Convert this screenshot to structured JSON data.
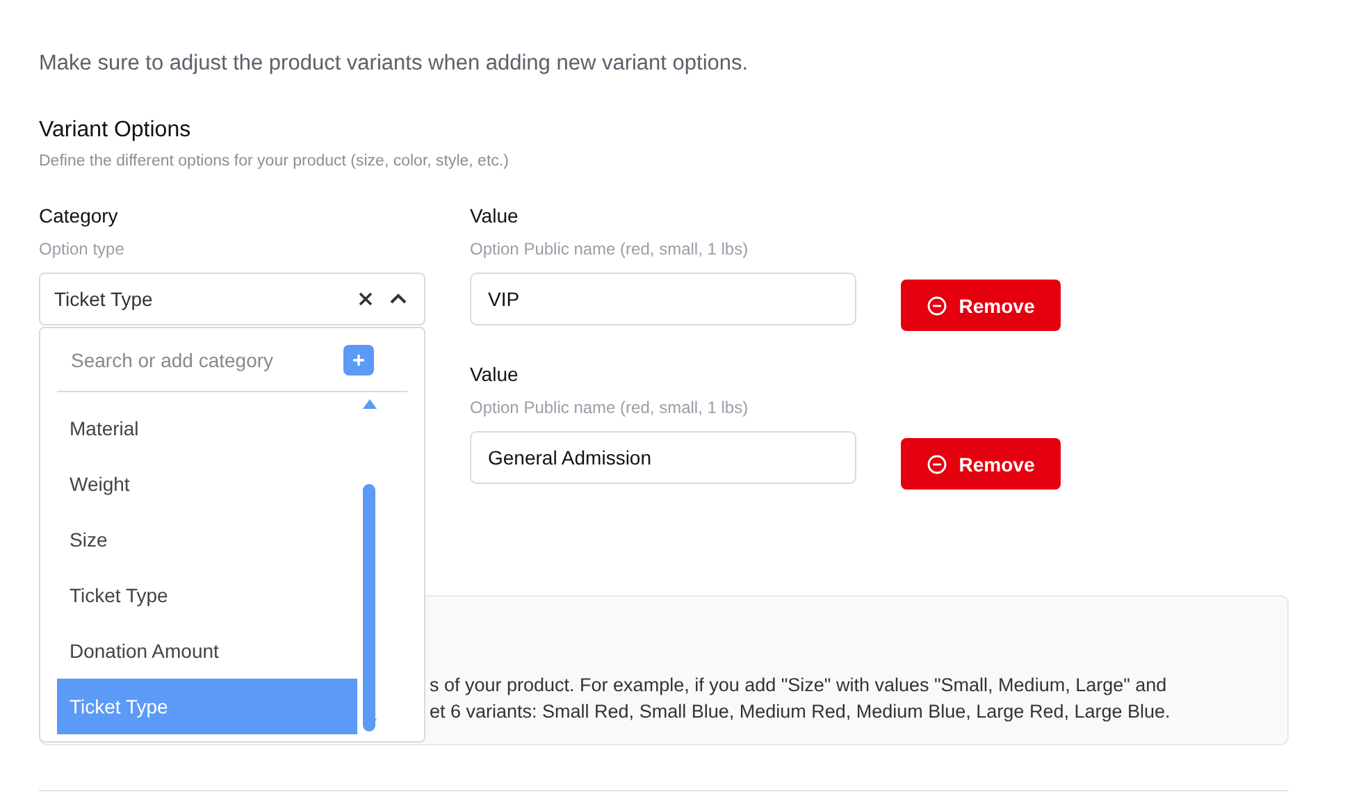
{
  "notice": "Make sure to adjust the product variants when adding new variant options.",
  "section": {
    "title": "Variant Options",
    "subtitle": "Define the different options for your product (size, color, style, etc.)"
  },
  "options": [
    {
      "category_label": "Category",
      "category_hint": "Option type",
      "category_value": "Ticket Type",
      "value_label": "Value",
      "value_hint": "Option Public name (red, small, 1 lbs)",
      "value": "VIP",
      "remove_button": "Remove"
    },
    {
      "value_label": "Value",
      "value_hint": "Option Public name (red, small, 1 lbs)",
      "value": "General Admission",
      "remove_button": "Remove"
    }
  ],
  "dropdown": {
    "search_placeholder": "Search or add category",
    "items": [
      {
        "label": "Material",
        "selected": false
      },
      {
        "label": "Weight",
        "selected": false
      },
      {
        "label": "Size",
        "selected": false
      },
      {
        "label": "Ticket Type",
        "selected": false
      },
      {
        "label": "Donation Amount",
        "selected": false
      },
      {
        "label": "Ticket Type",
        "selected": true
      }
    ]
  },
  "info_box": {
    "lines": [
      "s of your product. For example, if you add \"Size\" with values \"Small, Medium, Large\" and",
      "et 6 variants: Small Red, Small Blue, Medium Red, Medium Blue, Large Red, Large Blue."
    ]
  }
}
